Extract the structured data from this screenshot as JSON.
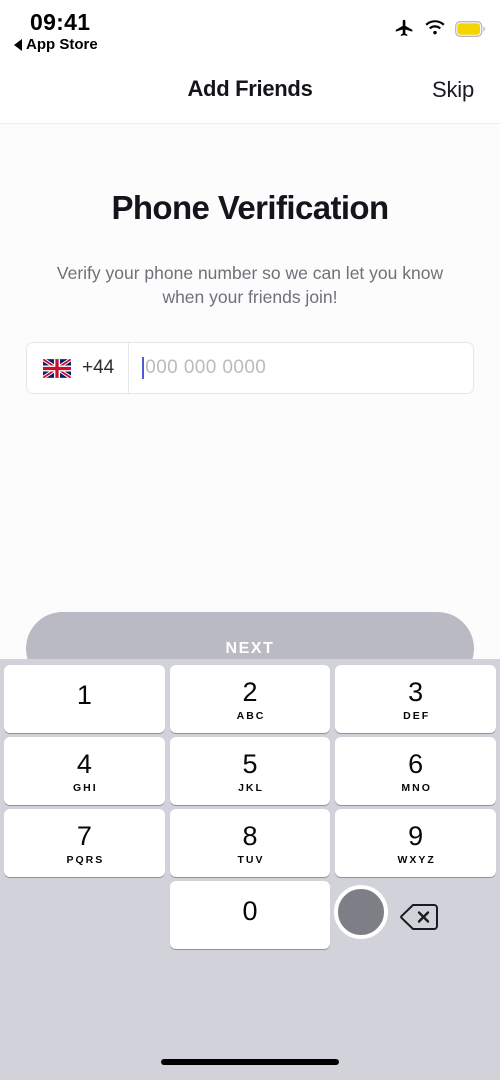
{
  "status_bar": {
    "time": "09:41",
    "back_label": "App Store",
    "back_icon": "triangle-left-icon",
    "icons": [
      "airplane-mode-icon",
      "wifi-icon",
      "battery-icon"
    ],
    "battery_color": "#f5d500"
  },
  "nav_bar": {
    "title": "Add Friends",
    "skip_label": "Skip"
  },
  "main": {
    "headline": "Phone Verification",
    "subtitle": "Verify your phone number so we can let you know when your friends join!",
    "phone_input": {
      "country_flag": "uk-flag-icon",
      "country_code": "+44",
      "placeholder": "000 000 0000",
      "value": "",
      "caret_color": "#4f5bd5"
    },
    "next_button": {
      "label": "NEXT",
      "bg_color": "#b9bac4",
      "text_color": "#ffffff",
      "enabled": false
    }
  },
  "keypad": {
    "bg_color": "#d1d2da",
    "rows": [
      [
        {
          "digit": "1",
          "letters": ""
        },
        {
          "digit": "2",
          "letters": "ABC"
        },
        {
          "digit": "3",
          "letters": "DEF"
        }
      ],
      [
        {
          "digit": "4",
          "letters": "GHI"
        },
        {
          "digit": "5",
          "letters": "JKL"
        },
        {
          "digit": "6",
          "letters": "MNO"
        }
      ],
      [
        {
          "digit": "7",
          "letters": "PQRS"
        },
        {
          "digit": "8",
          "letters": "TUV"
        },
        {
          "digit": "9",
          "letters": "WXYZ"
        }
      ]
    ],
    "zero_key": {
      "digit": "0",
      "letters": ""
    },
    "backspace_icon": "backspace-delete-icon",
    "touch_indicator": "tap-indicator-dot"
  },
  "home_indicator": "home-bar-indicator"
}
